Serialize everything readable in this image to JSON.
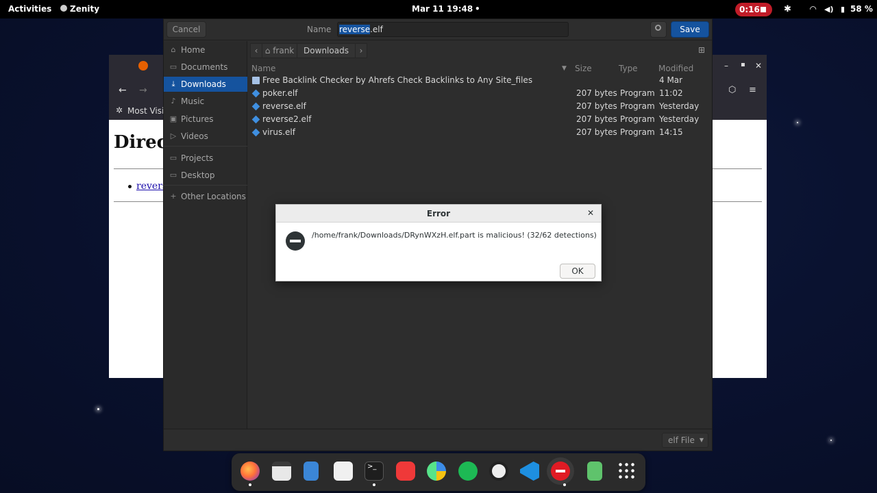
{
  "topbar": {
    "activities": "Activities",
    "app_name": "Zenity",
    "datetime": "Mar 11  19:48",
    "recording_time": "0:16",
    "battery": "58 %"
  },
  "background_window": {
    "bookmark": "Most Visi",
    "heading": "Direc",
    "link_text": "revers"
  },
  "chooser": {
    "cancel_label": "Cancel",
    "name_label": "Name",
    "filename_selected": "reverse",
    "filename_rest": ".elf",
    "save_label": "Save",
    "sidebar": {
      "home": "Home",
      "documents": "Documents",
      "downloads": "Downloads",
      "music": "Music",
      "pictures": "Pictures",
      "videos": "Videos",
      "projects": "Projects",
      "desktop": "Desktop",
      "other_locations": "Other Locations"
    },
    "path": {
      "home": "frank",
      "current": "Downloads"
    },
    "columns": {
      "name": "Name",
      "size": "Size",
      "type": "Type",
      "modified": "Modified"
    },
    "files": [
      {
        "name": "Free Backlink Checker by Ahrefs Check Backlinks to Any Site_files",
        "size": "",
        "type": "",
        "modified": "4 Mar",
        "kind": "folder"
      },
      {
        "name": "poker.elf",
        "size": "207 bytes",
        "type": "Program",
        "modified": "11:02",
        "kind": "file"
      },
      {
        "name": "reverse.elf",
        "size": "207 bytes",
        "type": "Program",
        "modified": "Yesterday",
        "kind": "file"
      },
      {
        "name": "reverse2.elf",
        "size": "207 bytes",
        "type": "Program",
        "modified": "Yesterday",
        "kind": "file"
      },
      {
        "name": "virus.elf",
        "size": "207 bytes",
        "type": "Program",
        "modified": "14:15",
        "kind": "file"
      }
    ],
    "filter": "elf File"
  },
  "error_dialog": {
    "title": "Error",
    "message": "/home/frank/Downloads/DRynWXzH.elf.part is malicious! (32/62 detections)",
    "ok_label": "OK"
  },
  "dock_apps": [
    "firefox-icon",
    "calendar-icon",
    "text-editor-icon",
    "software-icon",
    "terminal-icon",
    "vivaldi-icon",
    "disk-usage-icon",
    "spotify-icon",
    "obs-icon",
    "vscode-icon",
    "stop-sign-icon",
    "trash-icon",
    "app-grid-icon"
  ]
}
